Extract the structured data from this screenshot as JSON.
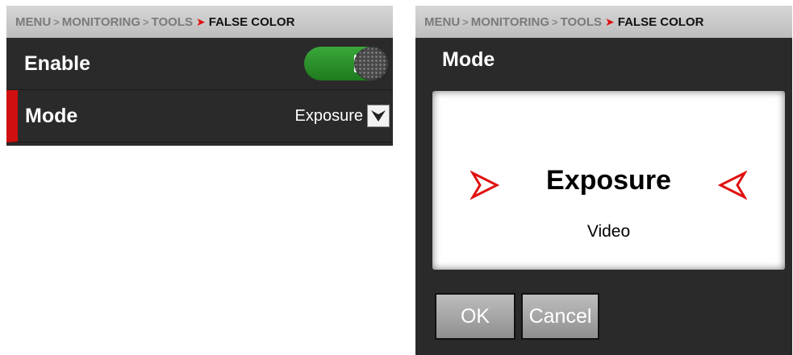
{
  "left_panel": {
    "breadcrumb": {
      "items": [
        "MENU",
        "MONITORING",
        "TOOLS"
      ],
      "current": "FALSE COLOR",
      "separator": ">",
      "active_separator": "➤"
    },
    "rows": {
      "enable": {
        "label": "Enable",
        "toggle_on": true
      },
      "mode": {
        "label": "Mode",
        "value": "Exposure"
      }
    }
  },
  "right_panel": {
    "breadcrumb": {
      "items": [
        "MENU",
        "MONITORING",
        "TOOLS"
      ],
      "current": "FALSE COLOR",
      "separator": ">",
      "active_separator": "➤"
    },
    "title": "Mode",
    "picker": {
      "selected": "Exposure",
      "next": "Video"
    },
    "buttons": {
      "ok": "OK",
      "cancel": "Cancel"
    }
  },
  "colors": {
    "accent_red": "#d01010",
    "toggle_green": "#2a9a2a",
    "panel_bg": "#2a2a2a"
  }
}
